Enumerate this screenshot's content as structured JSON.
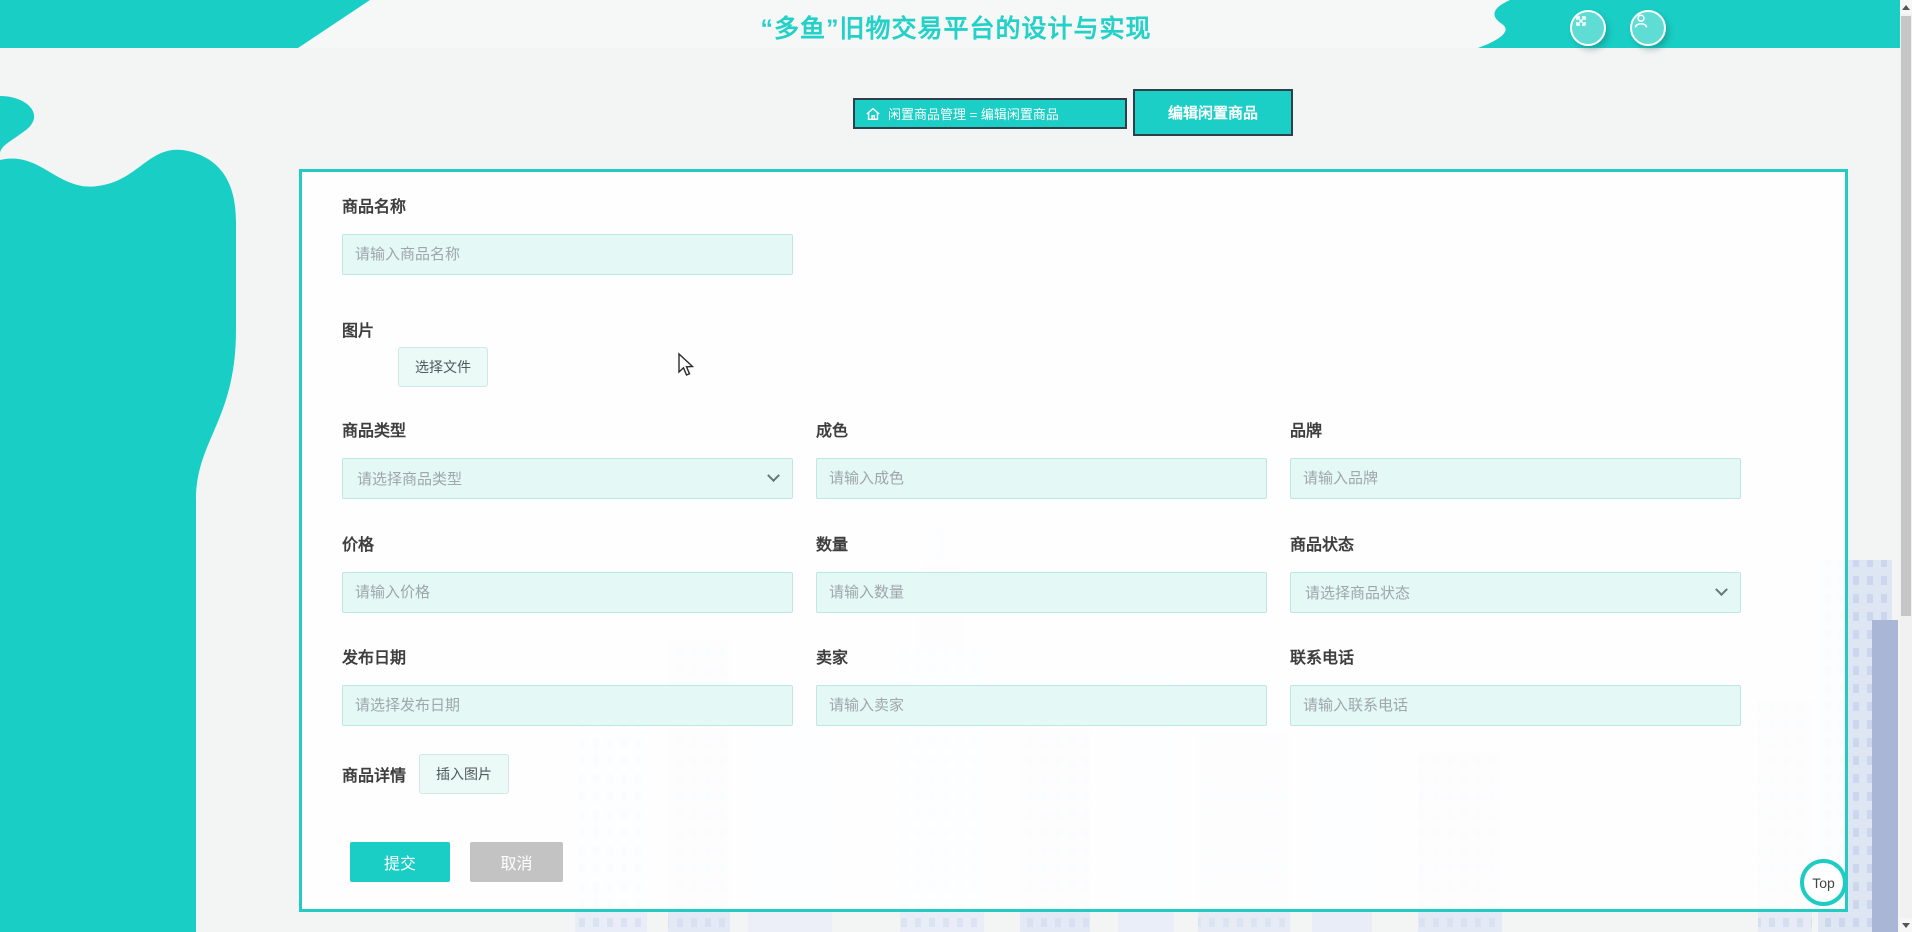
{
  "colors": {
    "accent": "#1bcfc6",
    "breadcrumb_border": "#2e4049",
    "title_color": "#23d1c8",
    "input_bg": "#e4f8f5",
    "input_border": "#bfe7e1",
    "submit_bg": "#1bcec5",
    "cancel_bg": "#c3c3c3"
  },
  "header": {
    "title": "“多鱼”旧物交易平台的设计与实现",
    "icons": [
      "fullscreen-icon",
      "user-icon"
    ]
  },
  "breadcrumb": {
    "home_icon": "home-icon",
    "path": "闲置商品管理 = 编辑闲置商品",
    "tab": "编辑闲置商品"
  },
  "form": {
    "fields": {
      "name": {
        "label": "商品名称",
        "placeholder": "请输入商品名称"
      },
      "image": {
        "label": "图片",
        "button": "选择文件"
      },
      "type": {
        "label": "商品类型",
        "placeholder": "请选择商品类型"
      },
      "condition": {
        "label": "成色",
        "placeholder": "请输入成色"
      },
      "brand": {
        "label": "品牌",
        "placeholder": "请输入品牌"
      },
      "price": {
        "label": "价格",
        "placeholder": "请输入价格"
      },
      "quantity": {
        "label": "数量",
        "placeholder": "请输入数量"
      },
      "status": {
        "label": "商品状态",
        "placeholder": "请选择商品状态"
      },
      "date": {
        "label": "发布日期",
        "placeholder": "请选择发布日期"
      },
      "seller": {
        "label": "卖家",
        "placeholder": "请输入卖家"
      },
      "phone": {
        "label": "联系电话",
        "placeholder": "请输入联系电话"
      },
      "detail": {
        "label": "商品详情",
        "button": "插入图片"
      }
    },
    "actions": {
      "submit": "提交",
      "cancel": "取消"
    }
  },
  "top_button": {
    "label": "Top"
  }
}
